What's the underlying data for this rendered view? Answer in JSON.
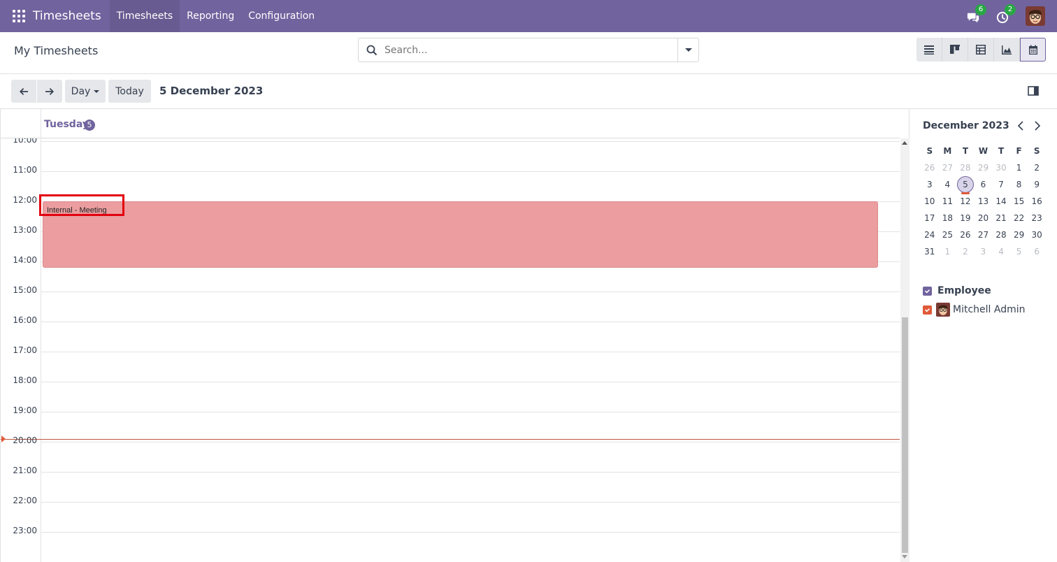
{
  "navbar": {
    "brand": "Timesheets",
    "menu": [
      {
        "label": "Timesheets"
      },
      {
        "label": "Reporting"
      },
      {
        "label": "Configuration"
      }
    ],
    "messages_count": "6",
    "activities_count": "2",
    "bg_color": "#71639e"
  },
  "control_panel": {
    "title": "My Timesheets",
    "search_placeholder": "Search...",
    "views": [
      "list-icon",
      "kanban-icon",
      "pivot-icon",
      "graph-icon",
      "calendar-icon"
    ],
    "active_view": "calendar-icon"
  },
  "calendar_toolbar": {
    "scale_label": "Day",
    "today_label": "Today",
    "date_title": "5 December 2023"
  },
  "day_view": {
    "day_name": "Tuesday",
    "day_number": "5",
    "hours": [
      "10:00",
      "11:00",
      "12:00",
      "13:00",
      "14:00",
      "15:00",
      "16:00",
      "17:00",
      "18:00",
      "19:00",
      "20:00",
      "21:00",
      "22:00",
      "23:00"
    ],
    "event": {
      "title": "Internal - Meeting",
      "color": "#eb9d9f"
    }
  },
  "mini_calendar": {
    "title": "December 2023",
    "weekdays": [
      "S",
      "M",
      "T",
      "W",
      "T",
      "F",
      "S"
    ],
    "weeks": [
      [
        "26",
        "27",
        "28",
        "29",
        "30",
        "1",
        "2"
      ],
      [
        "3",
        "4",
        "5",
        "6",
        "7",
        "8",
        "9"
      ],
      [
        "10",
        "11",
        "12",
        "13",
        "14",
        "15",
        "16"
      ],
      [
        "17",
        "18",
        "19",
        "20",
        "21",
        "22",
        "23"
      ],
      [
        "24",
        "25",
        "26",
        "27",
        "28",
        "29",
        "30"
      ],
      [
        "31",
        "1",
        "2",
        "3",
        "4",
        "5",
        "6"
      ]
    ],
    "today": "5"
  },
  "filters": {
    "section_label": "Employee",
    "section_color": "#71639e",
    "items": [
      {
        "label": "Mitchell Admin",
        "color": "#e05a3a"
      }
    ]
  }
}
